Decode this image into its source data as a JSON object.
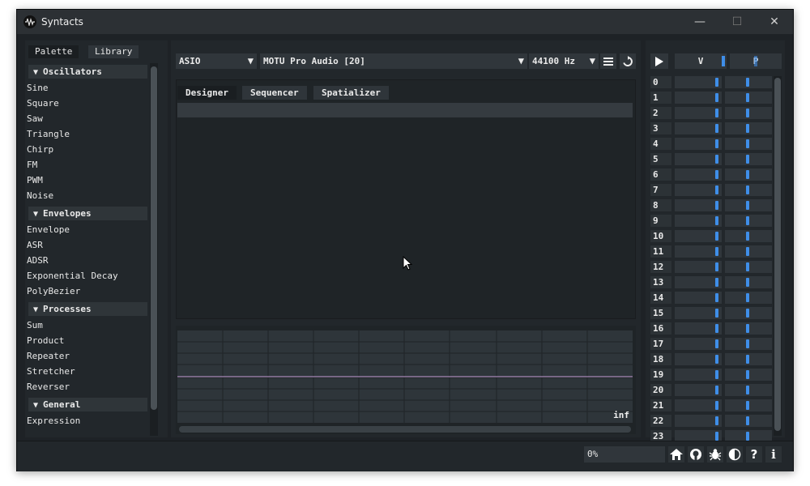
{
  "window": {
    "title": "Syntacts",
    "minimize": "—",
    "maximize": "☐",
    "close": "✕"
  },
  "palette": {
    "tabs": [
      "Palette",
      "Library"
    ],
    "sections": [
      {
        "title": "Oscillators",
        "items": [
          "Sine",
          "Square",
          "Saw",
          "Triangle",
          "Chirp",
          "FM",
          "PWM",
          "Noise"
        ]
      },
      {
        "title": "Envelopes",
        "items": [
          "Envelope",
          "ASR",
          "ADSR",
          "Exponential Decay",
          "PolyBezier"
        ]
      },
      {
        "title": "Processes",
        "items": [
          "Sum",
          "Product",
          "Repeater",
          "Stretcher",
          "Reverser"
        ]
      },
      {
        "title": "General",
        "items": [
          "Expression"
        ]
      }
    ]
  },
  "toolbar": {
    "api": "ASIO",
    "device": "MOTU Pro Audio [20]",
    "sample_rate": "44100 Hz"
  },
  "editor_tabs": [
    "Designer",
    "Sequencer",
    "Spatializer"
  ],
  "plot": {
    "label": "inf"
  },
  "channels": {
    "header_v": "V",
    "header_p": "P",
    "list": [
      "0",
      "1",
      "2",
      "3",
      "4",
      "5",
      "6",
      "7",
      "8",
      "9",
      "10",
      "11",
      "12",
      "13",
      "14",
      "15",
      "16",
      "17",
      "18",
      "19",
      "20",
      "21",
      "22",
      "23"
    ]
  },
  "status": {
    "progress": "0%"
  },
  "colors": {
    "accent": "#3f8ee8",
    "plot_line": "#c8a0d8"
  }
}
